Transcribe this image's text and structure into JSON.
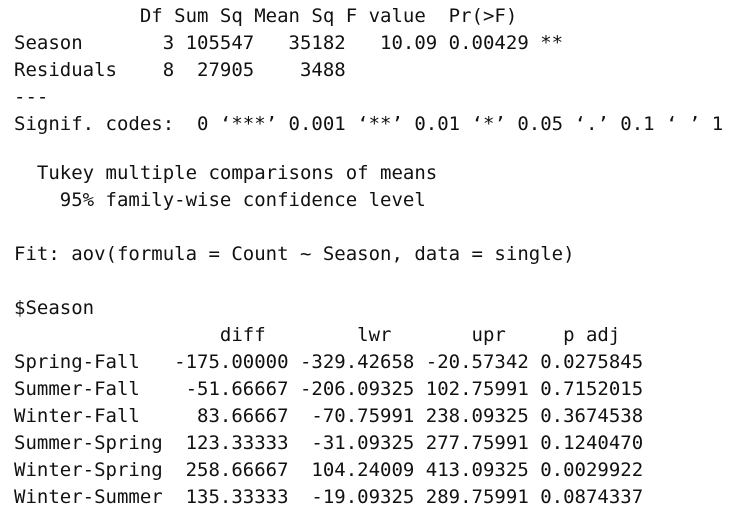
{
  "anova": {
    "header": "           Df Sum Sq Mean Sq F value  Pr(>F)   ",
    "rows": [
      "Season       3 105547   35182   10.09 0.00429 **",
      "Residuals    8  27905    3488                 "
    ],
    "separator": "---",
    "signif_codes": "Signif. codes:  0 ‘***’ 0.001 ‘**’ 0.01 ‘*’ 0.05 ‘.’ 0.1 ‘ ’ 1"
  },
  "tukey": {
    "title": "  Tukey multiple comparisons of means",
    "confidence": "    95% family-wise confidence level",
    "fit": "Fit: aov(formula = Count ~ Season, data = single)",
    "factor_label": "$Season",
    "table_header": "                  diff        lwr       upr     p adj",
    "rows": [
      "Spring-Fall   -175.00000 -329.42658 -20.57342 0.0275845",
      "Summer-Fall    -51.66667 -206.09325 102.75991 0.7152015",
      "Winter-Fall     83.66667  -70.75991 238.09325 0.3674538",
      "Summer-Spring  123.33333  -31.09325 277.75991 0.1240470",
      "Winter-Spring  258.66667  104.24009 413.09325 0.0029922",
      "Winter-Summer  135.33333  -19.09325 289.75991 0.0874337"
    ]
  }
}
